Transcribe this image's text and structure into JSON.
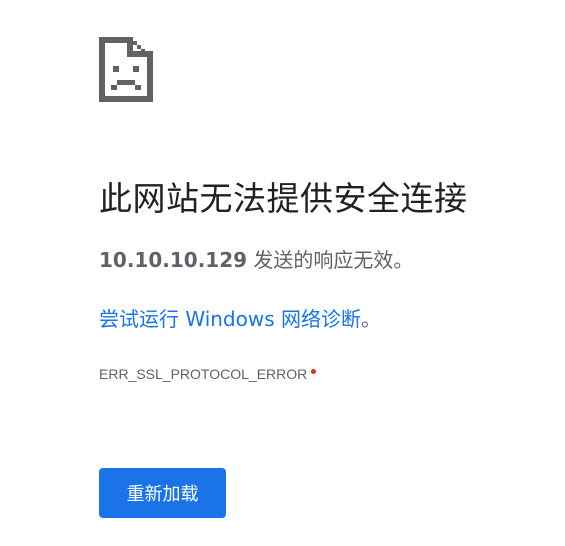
{
  "icon": "sad-page-icon",
  "error": {
    "title": "此网站无法提供安全连接",
    "host": "10.10.10.129",
    "summary_suffix": " 发送的响应无效。",
    "suggestion_link": "尝试运行 Windows 网络诊断",
    "suggestion_end": "。",
    "code": "ERR_SSL_PROTOCOL_ERROR"
  },
  "buttons": {
    "reload_label": "重新加载"
  },
  "colors": {
    "accent": "#1a73e8",
    "title_text": "#202124",
    "body_text": "#5f6368",
    "error_dot": "#d93025"
  }
}
